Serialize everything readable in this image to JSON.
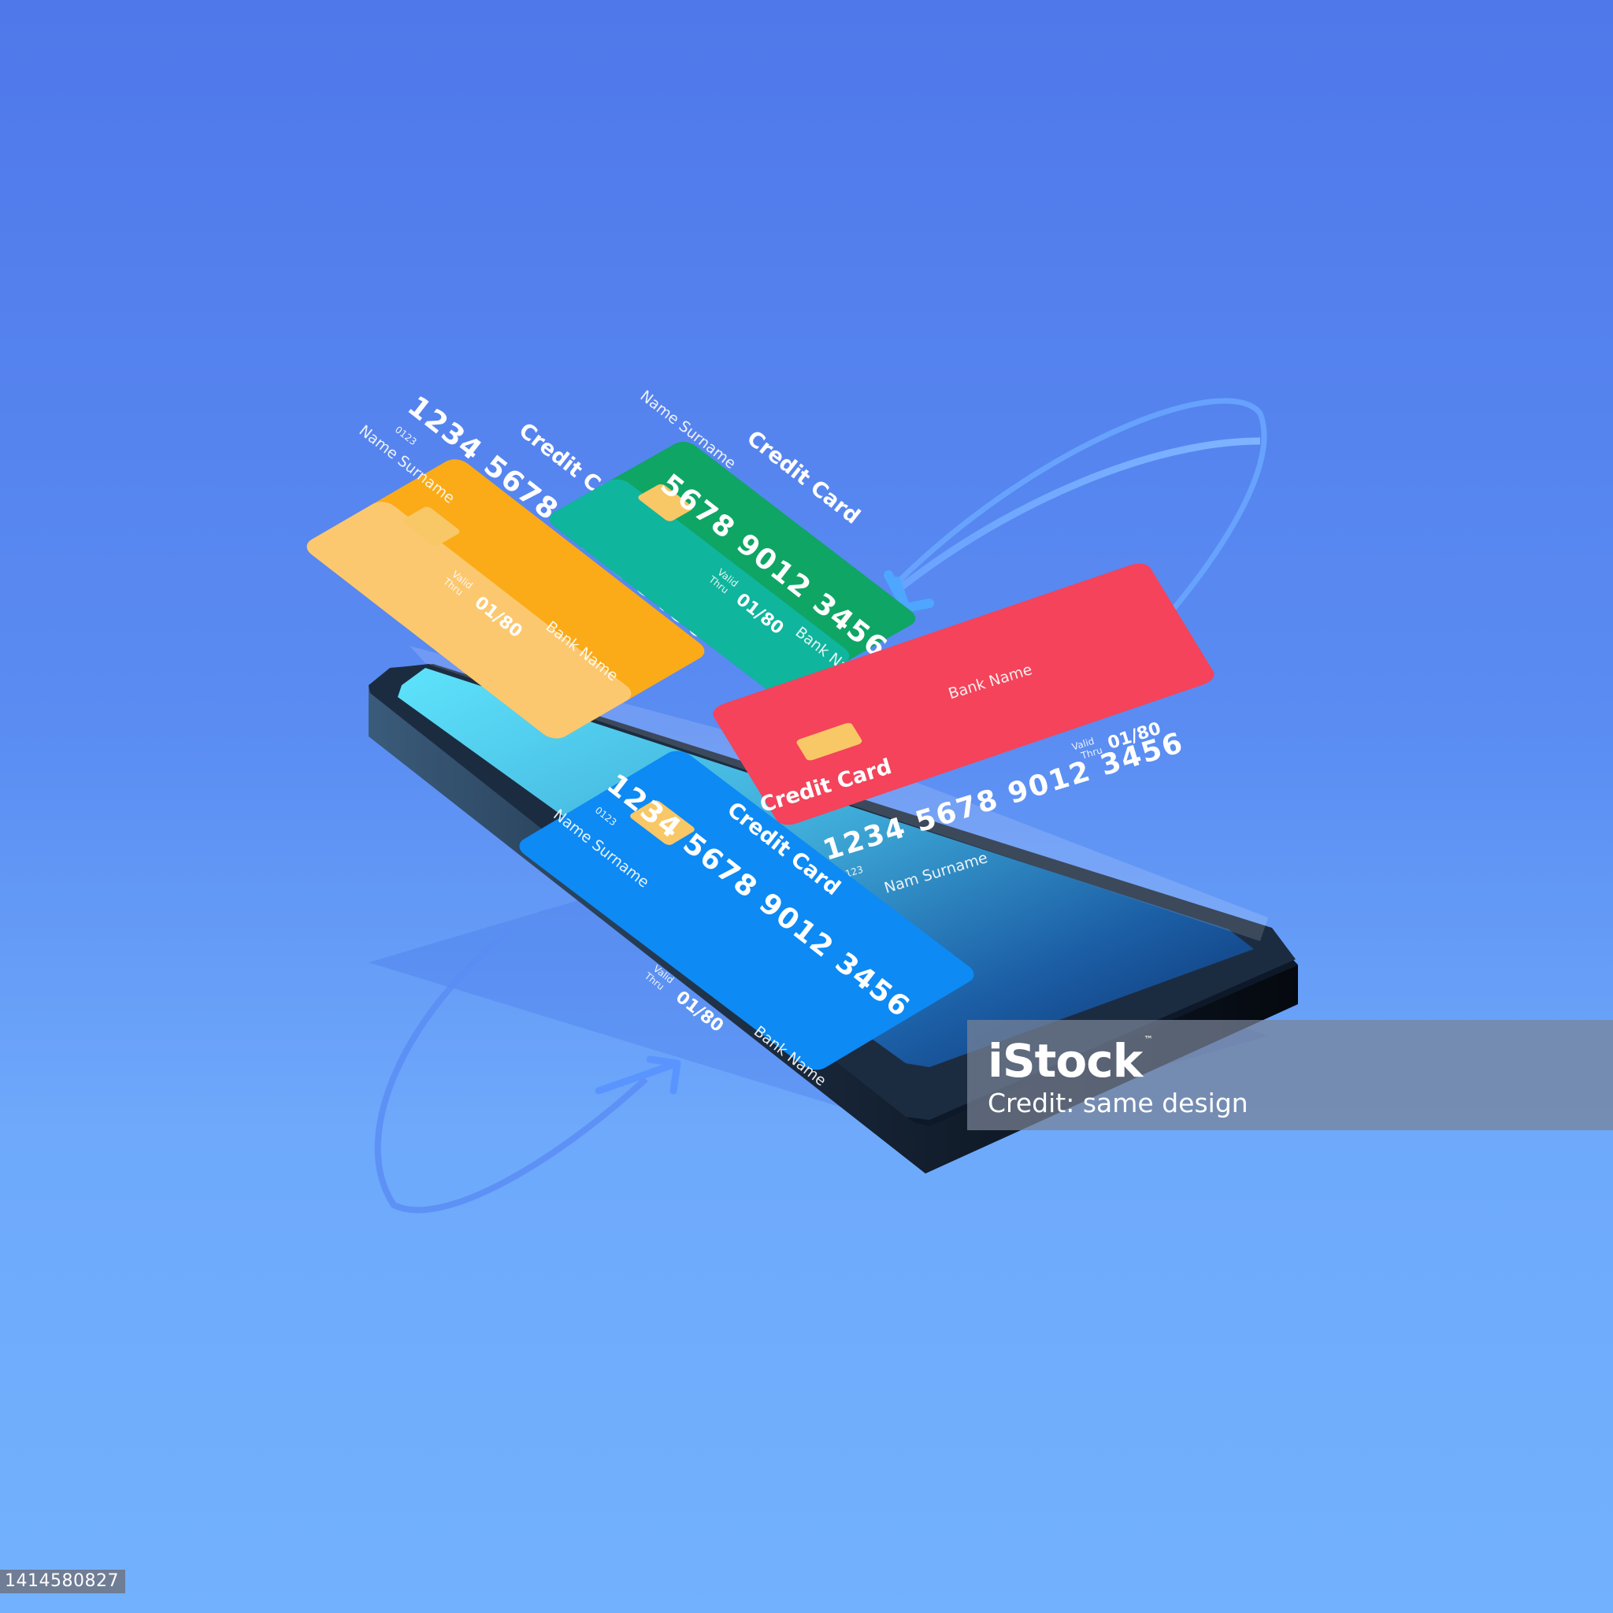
{
  "colors": {
    "card_orange": "#fbab18",
    "card_green": "#0fa565",
    "card_red": "#f4435a",
    "card_blue": "#0d8af4",
    "chip": "#f8c766",
    "screen": "#4fd3f7",
    "phone_body": "#0c1523"
  },
  "icons": {
    "orbit_arrow": "curved-arrow-icon",
    "chip": "card-chip-icon"
  },
  "cards": [
    {
      "color": "orange",
      "title": "Credit Card",
      "number": "1234 5678 9012 3456",
      "code": "0123",
      "holder": "Name Surname",
      "bank": "Bank Name",
      "valid_label_1": "Valid",
      "valid_label_2": "Thru",
      "valid": "01/80"
    },
    {
      "color": "green",
      "title": "Credit Card",
      "number": "5678 9012 3456",
      "holder": "Name Surname",
      "bank": "Bank Na",
      "valid_label_1": "Valid",
      "valid_label_2": "Thru",
      "valid": "01/80"
    },
    {
      "color": "red",
      "title": "Credit Card",
      "number": "1234 5678 9012 3456",
      "code": "0123",
      "holder": "Nam  Surname",
      "bank": "Bank Name",
      "valid_label_1": "Valid",
      "valid_label_2": "Thru",
      "valid": "01/80"
    },
    {
      "color": "blue",
      "title": "Credit Card",
      "number": "1234 5678 9012 3456",
      "code": "0123",
      "holder": "Name Surname",
      "bank": "Bank Name",
      "valid_label_1": "Valid",
      "valid_label_2": "Thru",
      "valid": "01/80"
    }
  ],
  "watermark": {
    "brand": "iStock",
    "tm": "™",
    "credit": "Credit: same design"
  },
  "image_id": "1414580827"
}
